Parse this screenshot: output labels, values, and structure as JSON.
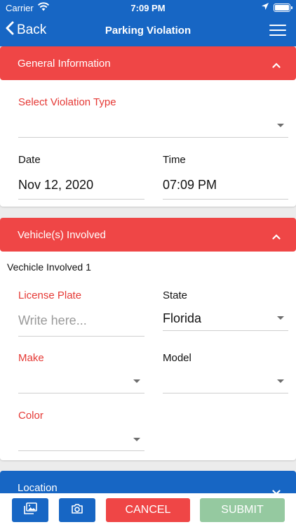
{
  "status_bar": {
    "carrier": "Carrier",
    "time": "7:09 PM"
  },
  "nav": {
    "back_label": "Back",
    "title": "Parking Violation"
  },
  "general": {
    "header": "General Information",
    "violation_type_label": "Select Violation Type",
    "violation_type_value": "",
    "date_label": "Date",
    "date_value": "Nov 12, 2020",
    "time_label": "Time",
    "time_value": "07:09 PM"
  },
  "vehicles": {
    "header": "Vehicle(s) Involved",
    "subtitle": "Vechicle Involved 1",
    "license_plate_label": "License Plate",
    "license_plate_placeholder": "Write here...",
    "state_label": "State",
    "state_value": "Florida",
    "make_label": "Make",
    "model_label": "Model",
    "color_label": "Color"
  },
  "location": {
    "header": "Location"
  },
  "bottom_bar": {
    "cancel_label": "CANCEL",
    "submit_label": "SUBMIT"
  },
  "colors": {
    "primary_blue": "#1766c4",
    "accent_red": "#ef4646",
    "submit_green": "#95c9a0",
    "required_label": "#e53935"
  },
  "icons": [
    "wifi-icon",
    "location-arrow-icon",
    "battery-icon",
    "chevron-left-icon",
    "hamburger-menu-icon",
    "chevron-up-icon",
    "chevron-down-icon",
    "gallery-icon",
    "camera-icon"
  ]
}
